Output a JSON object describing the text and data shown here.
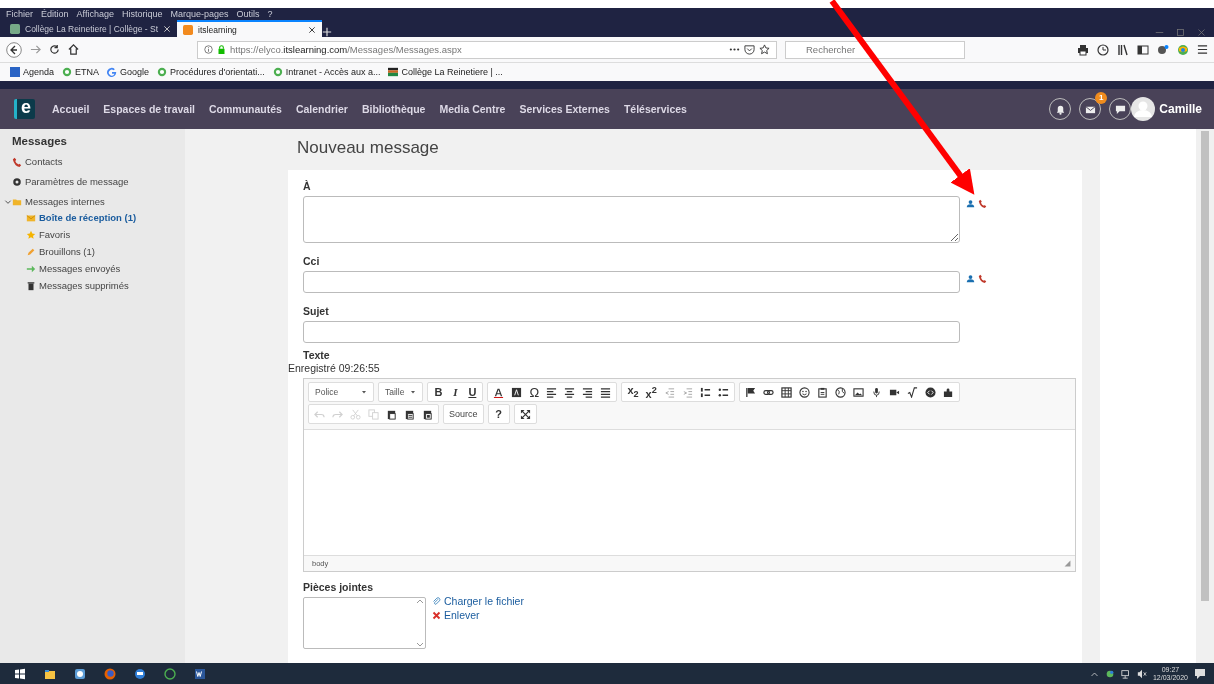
{
  "browser": {
    "menu": [
      "Fichier",
      "Édition",
      "Affichage",
      "Historique",
      "Marque-pages",
      "Outils",
      "?"
    ],
    "tabs": [
      {
        "title": "Collège La Reinetiere | Collège - St",
        "selected": false
      },
      {
        "title": "itslearning",
        "selected": true
      }
    ],
    "url": "https://elyco.**itslearning.com**/Messages/Messages.aspx",
    "search": {
      "placeholder": "Rechercher"
    },
    "bookmarks": [
      "Agenda",
      "ETNA",
      "Google",
      "Procédures d'orientati...",
      "Intranet - Accès aux a...",
      "Collège La Reinetiere | ..."
    ]
  },
  "app": {
    "logo": "e",
    "nav": [
      "Accueil",
      "Espaces de travail",
      "Communautés",
      "Calendrier",
      "Bibliothèque",
      "Media Centre",
      "Services Externes",
      "Téléservices"
    ],
    "mail_badge": "1",
    "user": "Camille"
  },
  "sidebar": {
    "title": "Messages",
    "items": [
      {
        "label": "Contacts",
        "selected": false
      },
      {
        "label": "Paramètres de message",
        "selected": false
      },
      {
        "label": "Messages internes",
        "selected": false,
        "expanded": true,
        "children": [
          {
            "label": "Boîte de réception (1)",
            "selected": true
          },
          {
            "label": "Favoris",
            "selected": false
          },
          {
            "label": "Brouillons (1)",
            "selected": false
          },
          {
            "label": "Messages envoyés",
            "selected": false
          },
          {
            "label": "Messages supprimés",
            "selected": false
          }
        ]
      }
    ]
  },
  "compose": {
    "title": "Nouveau message",
    "fields": [
      {
        "label": "À",
        "kind": "textarea",
        "contacts": true
      },
      {
        "label": "Cci",
        "kind": "input",
        "contacts": true
      },
      {
        "label": "Sujet",
        "kind": "input",
        "contacts": false
      }
    ],
    "text_label": "Texte",
    "saved": "Enregistré 09:26:55",
    "editor": {
      "toolbar": [
        [
          [
            {
              "kind": "dropdown",
              "label": "Police"
            }
          ],
          [
            {
              "kind": "dropdown",
              "label": "Taille"
            }
          ],
          [
            {
              "kind": "text",
              "label": "B"
            },
            {
              "kind": "text",
              "label": "I"
            },
            {
              "kind": "text",
              "label": "U"
            }
          ],
          [
            {
              "kind": "icon",
              "disabled": false
            },
            {
              "kind": "icon",
              "disabled": false
            },
            {
              "kind": "text",
              "label": "Ω"
            },
            {
              "kind": "icon",
              "disabled": false
            },
            {
              "kind": "icon",
              "disabled": false
            },
            {
              "kind": "icon",
              "disabled": false
            },
            {
              "kind": "icon",
              "disabled": false
            }
          ],
          [
            {
              "kind": "text",
              "label": "x$_{2}$"
            },
            {
              "kind": "text",
              "label": "x$^{2}$"
            },
            {
              "kind": "icon",
              "disabled": true
            },
            {
              "kind": "icon",
              "disabled": true
            },
            {
              "kind": "icon",
              "disabled": false
            },
            {
              "kind": "icon",
              "disabled": false
            }
          ],
          [
            {
              "kind": "icon",
              "disabled": false
            },
            {
              "kind": "icon",
              "disabled": false
            },
            {
              "kind": "icon",
              "disabled": false
            },
            {
              "kind": "icon",
              "disabled": false
            },
            {
              "kind": "icon",
              "disabled": false
            },
            {
              "kind": "icon",
              "disabled": false
            },
            {
              "kind": "icon",
              "disabled": false
            },
            {
              "kind": "icon",
              "disabled": false
            },
            {
              "kind": "icon",
              "disabled": false
            },
            {
              "kind": "icon",
              "disabled": false
            },
            {
              "kind": "icon",
              "disabled": false
            },
            {
              "kind": "icon",
              "disabled": false
            }
          ]
        ],
        [
          [
            {
              "kind": "icon",
              "disabled": true
            },
            {
              "kind": "icon",
              "disabled": true
            },
            {
              "kind": "icon",
              "disabled": true
            },
            {
              "kind": "icon",
              "disabled": true
            },
            {
              "kind": "icon",
              "disabled": false
            },
            {
              "kind": "icon",
              "disabled": false
            },
            {
              "kind": "icon",
              "disabled": false
            }
          ],
          [
            {
              "kind": "text",
              "label": "Source"
            }
          ],
          [
            {
              "kind": "text",
              "label": "?"
            }
          ],
          [
            {
              "kind": "icon",
              "disabled": false
            }
          ]
        ]
      ],
      "path": "body"
    },
    "attachments": {
      "label": "Pièces jointes",
      "actions": [
        "Charger le fichier",
        "Enlever"
      ]
    }
  },
  "taskbar": {
    "time": "09:27",
    "date": "12/03/2020"
  }
}
